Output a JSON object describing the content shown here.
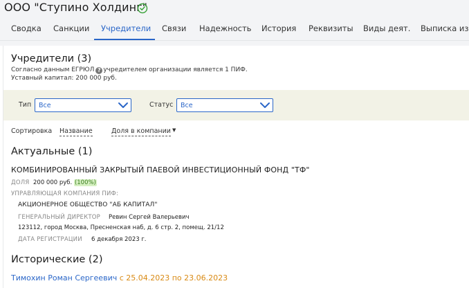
{
  "company": {
    "title": "ООО \"Ступино Холдинг\"",
    "verified_color": "#3aa23a"
  },
  "tabs": [
    {
      "label": "Сводка"
    },
    {
      "label": "Санкции"
    },
    {
      "label": "Учредители",
      "active": true
    },
    {
      "label": "Связи"
    },
    {
      "label": "Надежность"
    },
    {
      "label": "История"
    },
    {
      "label": "Реквизиты"
    },
    {
      "label": "Виды деят."
    },
    {
      "label": "Выписка из Е"
    }
  ],
  "founders": {
    "heading": "Учредители (3)",
    "note_prefix": "Согласно данным ЕГРЮЛ",
    "note_suffix": "учредителем организации является 1 ПИФ.",
    "capital": "Уставный капитал: 200 000 руб."
  },
  "filters": {
    "type_label": "Тип",
    "type_value": "Все",
    "status_label": "Статус",
    "status_value": "Все"
  },
  "sort": {
    "label": "Сортировка",
    "by_name": "Название",
    "by_share": "Доля в компании",
    "caret": "▼"
  },
  "current": {
    "heading": "Актуальные (1)",
    "fund_name": "КОМБИНИРОВАННЫЙ ЗАКРЫТЫЙ ПАЕВОЙ ИНВЕСТИЦИОННЫЙ ФОНД \"ТФ\"",
    "share_label": "ДОЛЯ",
    "share_value": "200 000 руб.",
    "share_pct": "(100%)",
    "mgmt_label": "УПРАВЛЯЮЩАЯ КОМПАНИЯ ПИФ:",
    "mgmt_name": "АКЦИОНЕРНОЕ ОБЩЕСТВО \"АБ КАПИТАЛ\"",
    "director_label": "ГЕНЕРАЛЬНЫЙ ДИРЕКТОР",
    "director_name": "Ревин Сергей Валерьевич",
    "address": "123112, город Москва, Пресненская наб, д. 6 стр. 2, помещ. 21/12",
    "reg_label": "ДАТА РЕГИСТРАЦИИ",
    "reg_date": "6 декабря 2023 г."
  },
  "historical": {
    "heading": "Исторические (2)",
    "items": [
      {
        "name": "Тимохин Роман Сергеевич",
        "period": "с 25.04.2023 по 23.06.2023"
      }
    ]
  },
  "colors": {
    "accent": "#2a66c8",
    "period": "#d98a14",
    "badge_bg": "#d6f0c2",
    "filter_bg": "#f2f2e6"
  }
}
